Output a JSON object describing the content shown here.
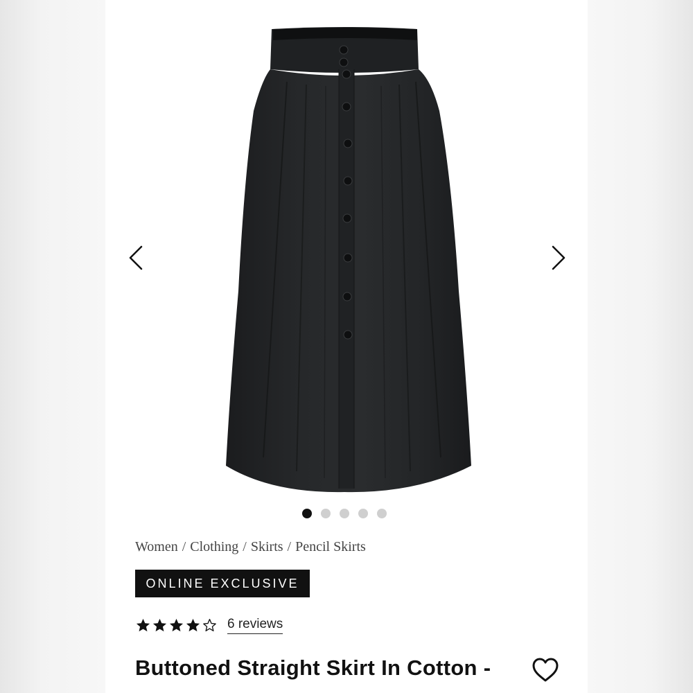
{
  "gallery": {
    "image_alt": "Black buttoned midi skirt",
    "prev_icon": "chevron-left-icon",
    "next_icon": "chevron-right-icon",
    "slide_count": 5,
    "active_slide": 1
  },
  "breadcrumb": [
    {
      "label": "Women"
    },
    {
      "label": "Clothing"
    },
    {
      "label": "Skirts"
    },
    {
      "label": "Pencil Skirts"
    }
  ],
  "breadcrumb_separator": "/",
  "badge": {
    "label": "ONLINE EXCLUSIVE"
  },
  "rating": {
    "value": 4,
    "max": 5,
    "reviews_label": "6 reviews"
  },
  "product": {
    "title": "Buttoned Straight Skirt In Cotton -"
  },
  "wishlist": {
    "icon": "heart-icon"
  },
  "colors": {
    "accent": "#111111",
    "dot_inactive": "#cfcfcf",
    "skirt": "#222426"
  }
}
